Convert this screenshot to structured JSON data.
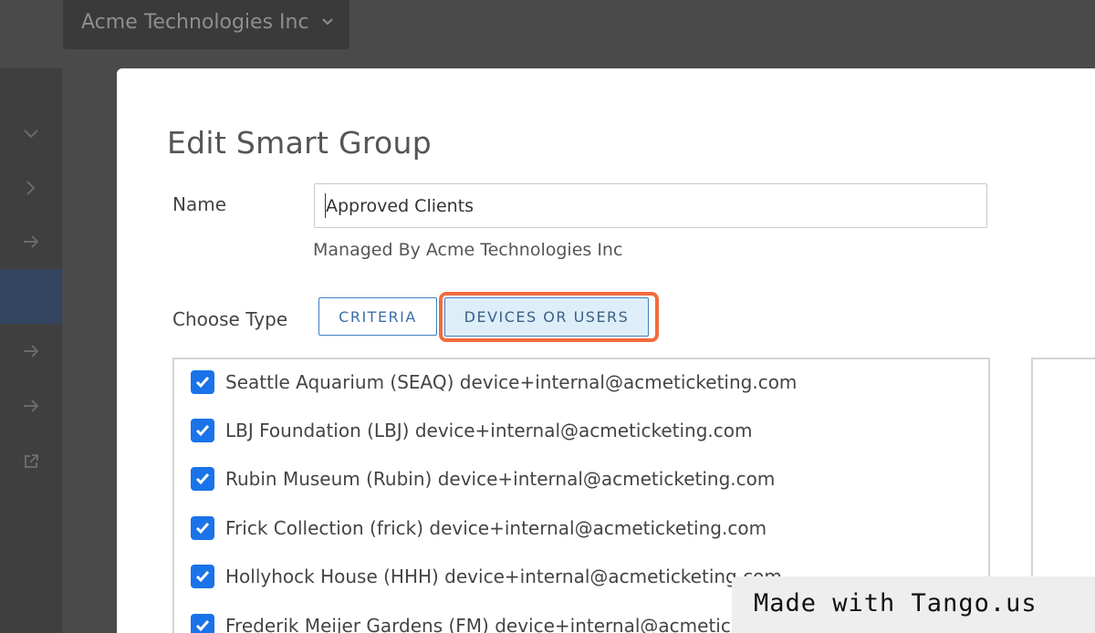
{
  "org_switcher": {
    "label": "Acme Technologies Inc",
    "icon": "chevron-down-icon"
  },
  "sidebar": {
    "icons": [
      "chevron-down-icon",
      "chevron-right-icon",
      "arrow-right-icon",
      "active-item",
      "arrow-right-icon",
      "arrow-right-icon",
      "external-link-icon"
    ]
  },
  "modal": {
    "title": "Edit Smart Group",
    "name_label": "Name",
    "name_value": "Approved Clients",
    "managed_by": "Managed By Acme Technologies Inc",
    "choose_type_label": "Choose Type",
    "type_buttons": {
      "criteria": "CRITERIA",
      "devices": "DEVICES OR USERS"
    },
    "selected_type": "DEVICES OR USERS",
    "items": [
      {
        "label": "Seattle Aquarium (SEAQ) device+internal@acmeticketing.com",
        "checked": true
      },
      {
        "label": "LBJ Foundation (LBJ) device+internal@acmeticketing.com",
        "checked": true
      },
      {
        "label": "Rubin Museum (Rubin) device+internal@acmeticketing.com",
        "checked": true
      },
      {
        "label": "Frick Collection (frick) device+internal@acmeticketing.com",
        "checked": true
      },
      {
        "label": "Hollyhock House (HHH) device+internal@acmeticketing.com",
        "checked": true
      },
      {
        "label": "Frederik Meijer Gardens (FM) device+internal@acmeticketing.com",
        "checked": true
      }
    ]
  },
  "colors": {
    "accent": "#1a73e8",
    "highlight": "#f26b3d",
    "selected_bg": "#ddeef8"
  },
  "watermark": "Made with Tango.us"
}
